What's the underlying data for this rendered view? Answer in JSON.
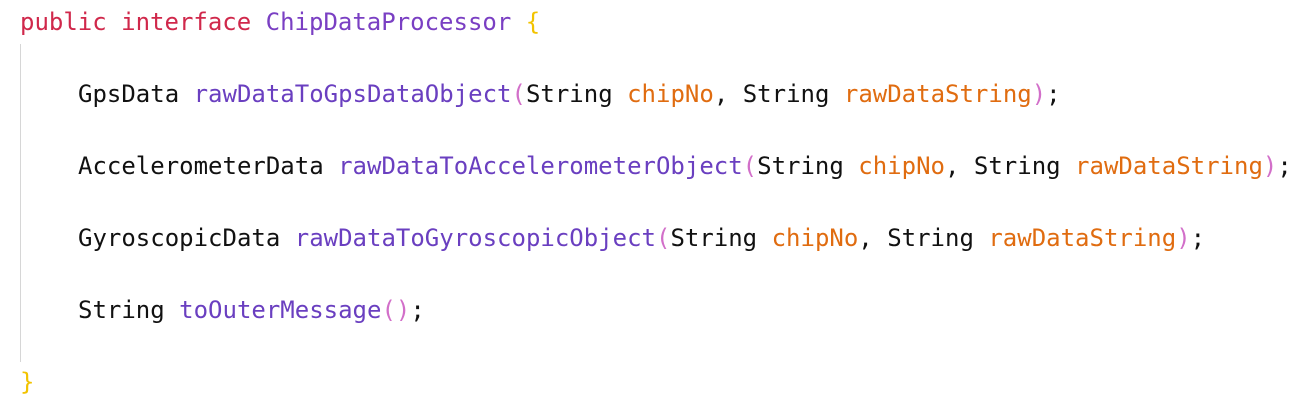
{
  "colors": {
    "keyword": "#d0284b",
    "type_name": "#7a3fc3",
    "method": "#6a3fc0",
    "param": "#e06c10",
    "brace": "#f2c300",
    "paren": "#d26fc9",
    "text": "#111111"
  },
  "code": {
    "line1": {
      "kw_public": "public",
      "kw_interface": "interface",
      "name": "ChipDataProcessor",
      "open_brace": "{"
    },
    "line2": {
      "return_type": "GpsData",
      "method": "rawDataToGpsDataObject",
      "lparen": "(",
      "type1": "String",
      "param1": "chipNo",
      "comma": ",",
      "type2": "String",
      "param2": "rawDataString",
      "rparen": ")",
      "semi": ";"
    },
    "line3": {
      "return_type": "AccelerometerData",
      "method": "rawDataToAccelerometerObject",
      "lparen": "(",
      "type1": "String",
      "param1": "chipNo",
      "comma": ",",
      "type2": "String",
      "param2": "rawDataString",
      "rparen": ")",
      "semi": ";"
    },
    "line4": {
      "return_type": "GyroscopicData",
      "method": "rawDataToGyroscopicObject",
      "lparen": "(",
      "type1": "String",
      "param1": "chipNo",
      "comma": ",",
      "type2": "String",
      "param2": "rawDataString",
      "rparen": ")",
      "semi": ";"
    },
    "line5": {
      "return_type": "String",
      "method": "toOuterMessage",
      "parens": "()",
      "semi": ";"
    },
    "line6": {
      "close_brace": "}"
    }
  }
}
